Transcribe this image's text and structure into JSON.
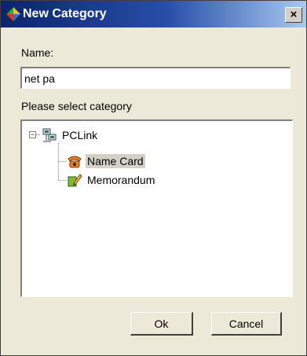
{
  "window": {
    "title": "New Category",
    "close_glyph": "×"
  },
  "form": {
    "name_label": "Name:",
    "name_value": "net pa",
    "category_label": "Please select category"
  },
  "tree": {
    "expander_glyph": "−",
    "nodes": [
      {
        "label": "PCLink",
        "icon": "computer-network-icon",
        "selected": false
      },
      {
        "label": "Name Card",
        "icon": "telephone-icon",
        "selected": true
      },
      {
        "label": "Memorandum",
        "icon": "memo-pencil-icon",
        "selected": false
      }
    ]
  },
  "buttons": {
    "ok_label": "Ok",
    "cancel_label": "Cancel"
  },
  "colors": {
    "title_gradient_start": "#0a246a",
    "title_gradient_end": "#a6caf0",
    "dialog_background": "#ece9d8",
    "selection_highlight": "#d4d0c8"
  }
}
